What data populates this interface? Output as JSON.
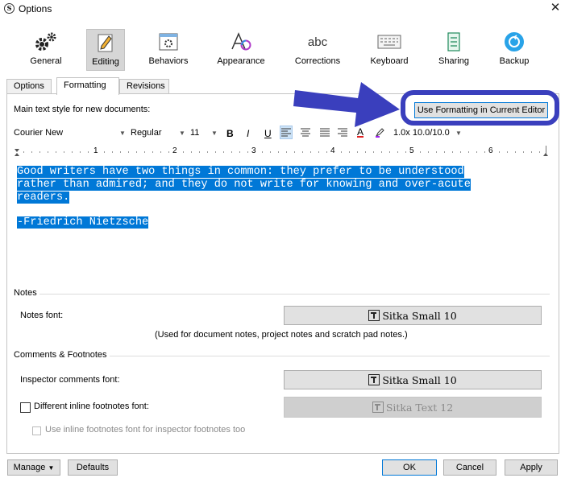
{
  "window": {
    "title": "Options",
    "app_icon": "S",
    "close_symbol": "✕"
  },
  "categories": [
    {
      "label": "General",
      "icon": "gears-icon"
    },
    {
      "label": "Editing",
      "icon": "pencil-icon",
      "selected": true
    },
    {
      "label": "Behaviors",
      "icon": "window-gear-icon"
    },
    {
      "label": "Appearance",
      "icon": "font-color-icon"
    },
    {
      "label": "Corrections",
      "icon": "abc-icon",
      "icon_text": "abc"
    },
    {
      "label": "Keyboard",
      "icon": "keyboard-icon"
    },
    {
      "label": "Sharing",
      "icon": "sharing-icon"
    },
    {
      "label": "Backup",
      "icon": "backup-icon"
    }
  ],
  "tabs": [
    {
      "label": "Options"
    },
    {
      "label": "Formatting",
      "active": true
    },
    {
      "label": "Revisions"
    }
  ],
  "formatting": {
    "main_style_label": "Main text style for new documents:",
    "use_formatting_button": "Use Formatting in Current Editor",
    "font_family": "Courier New",
    "font_style": "Regular",
    "font_size": "11",
    "bold": "B",
    "italic": "I",
    "underline": "U",
    "line_spacing": "1.0x 10.0/10.0",
    "ruler_numbers": [
      "1",
      "2",
      "3",
      "4",
      "5",
      "6"
    ],
    "sample_line1": "Good writers have two things in common: they prefer to be understood",
    "sample_line2": "rather than admired; and they do not write for knowing and over-acute",
    "sample_line3": "readers.",
    "sample_author": "-Friedrich Nietzsche"
  },
  "notes": {
    "section_label": "Notes",
    "font_label": "Notes font:",
    "font_value": "Sitka Small 10",
    "hint": "(Used for document notes, project notes and scratch pad notes.)"
  },
  "comments": {
    "section_label": "Comments & Footnotes",
    "inspector_label": "Inspector comments font:",
    "inspector_value": "Sitka Small 10",
    "inline_checkbox_label": "Different inline footnotes font:",
    "inline_value": "Sitka Text 12",
    "use_inline_label": "Use inline footnotes font for inspector footnotes too"
  },
  "footer": {
    "manage": "Manage",
    "defaults": "Defaults",
    "ok": "OK",
    "cancel": "Cancel",
    "apply": "Apply"
  },
  "colors": {
    "selection": "#0078d7",
    "annotation": "#3a3fbd",
    "accent": "#0078d7"
  }
}
